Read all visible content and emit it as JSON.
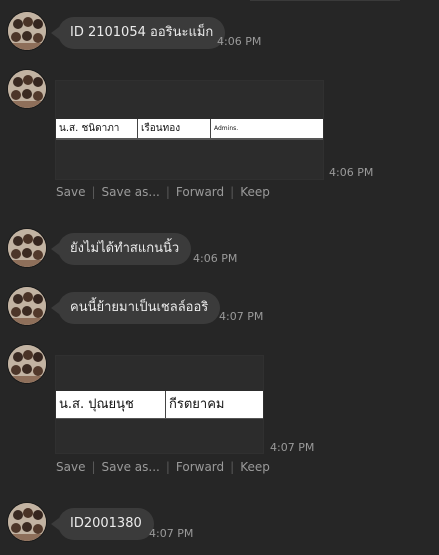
{
  "messages": [
    {
      "text": "ID 2101054 ออรินะแม็ก",
      "time": "4:06 PM"
    },
    {
      "attachment": {
        "cells": [
          "น.ส. ชนิดาภา",
          "เรือนทอง",
          "Admins."
        ]
      },
      "time": "4:06 PM",
      "actions": [
        "Save",
        "Save as...",
        "Forward",
        "Keep"
      ]
    },
    {
      "text": "ยังไม่ได้ทำสแกนนิ้ว",
      "time": "4:06 PM"
    },
    {
      "text": "คนนี้ย้ายมาเป็นเชลล์ออริ",
      "time": "4:07 PM"
    },
    {
      "attachment": {
        "cells": [
          "น.ส. ปุณยนุช",
          "กีรตยาคม"
        ]
      },
      "time": "4:07 PM",
      "actions": [
        "Save",
        "Save as...",
        "Forward",
        "Keep"
      ]
    },
    {
      "text": "ID2001380",
      "time": "4:07 PM"
    }
  ],
  "colors": {
    "background": "#262626",
    "bubble": "#3b3b3b",
    "timestamp": "#9a9a9a"
  }
}
